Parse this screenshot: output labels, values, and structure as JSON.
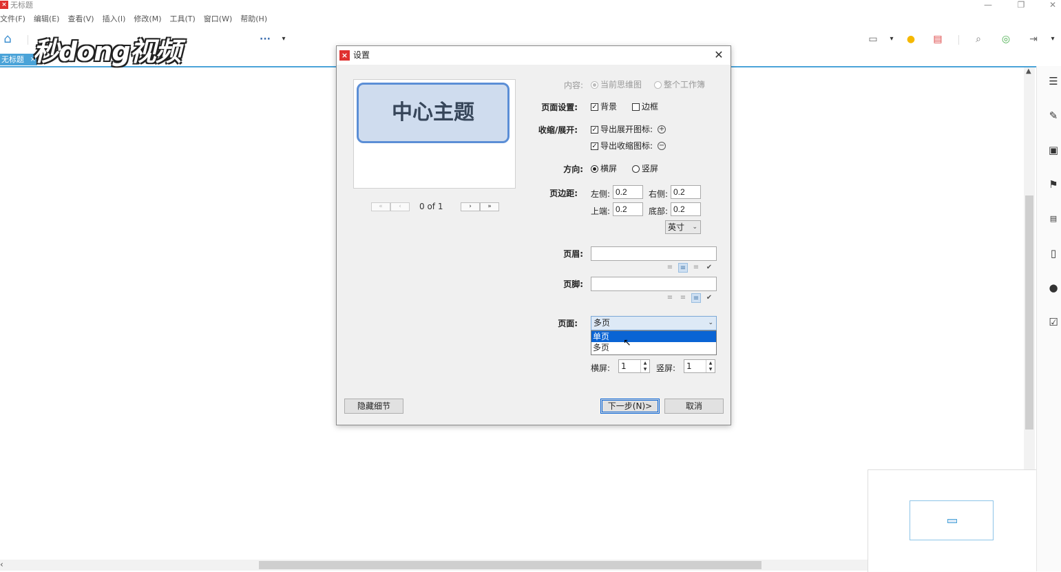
{
  "window": {
    "title": "无标题",
    "app_icon": "×",
    "minimize": "—",
    "restore": "❐",
    "close": "✕"
  },
  "menu": [
    "文件(F)",
    "编辑(E)",
    "查看(V)",
    "插入(I)",
    "修改(M)",
    "工具(T)",
    "窗口(W)",
    "帮助(H)"
  ],
  "toolbar": {
    "home": "⌂",
    "more": "···",
    "more_arrow": "▾",
    "present": "▭",
    "present_arrow": "▾",
    "idea": "●",
    "outline": "▤",
    "search": "⌕",
    "share": "◎",
    "export": "⇥",
    "export_arrow": "▾"
  },
  "doc_tab": {
    "label": "无标题",
    "close": "×"
  },
  "watermark": "秒dong视频",
  "dialog": {
    "title": "设置",
    "close": "✕",
    "preview_topic": "中心主题",
    "pager": {
      "first": "«",
      "prev": "‹",
      "text": "0  of  1",
      "next": "›",
      "last": "»"
    },
    "content": {
      "label": "内容:",
      "opt1": "当前思维图",
      "opt2": "整个工作簿"
    },
    "page_setup": {
      "label": "页面设置:",
      "background": "背景",
      "border": "边框"
    },
    "collapse": {
      "label": "收缩/展开:",
      "export_expand": "导出展开图标:",
      "export_collapse": "导出收缩图标:",
      "expand_sym": "+",
      "collapse_sym": "−"
    },
    "orientation": {
      "label": "方向:",
      "landscape": "横屏",
      "portrait": "竖屏"
    },
    "margins": {
      "label": "页边距:",
      "left_label": "左侧:",
      "left": "0.2",
      "right_label": "右侧:",
      "right": "0.2",
      "top_label": "上端:",
      "top": "0.2",
      "bottom_label": "底部:",
      "bottom": "0.2",
      "unit": "英寸"
    },
    "header": {
      "label": "页眉:",
      "value": ""
    },
    "footer": {
      "label": "页脚:",
      "value": ""
    },
    "align_icons": {
      "left": "≡",
      "center": "≡",
      "right": "≡",
      "check": "✔"
    },
    "pages": {
      "label": "页面:",
      "selected": "多页",
      "options": [
        "单页",
        "多页"
      ]
    },
    "tiles": {
      "h_label": "横屏:",
      "h_value": "1",
      "v_label": "竖屏:",
      "v_value": "1"
    },
    "buttons": {
      "hide": "隐藏细节",
      "next": "下一步(N)>",
      "cancel": "取消"
    }
  }
}
